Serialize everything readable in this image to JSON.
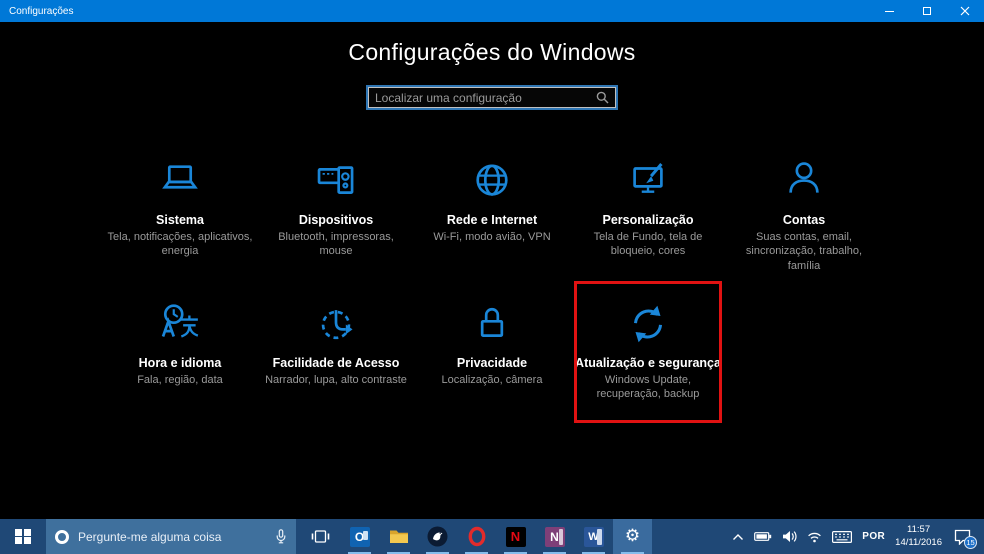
{
  "window": {
    "title": "Configurações"
  },
  "settings_app": {
    "heading": "Configurações do Windows",
    "search": {
      "placeholder": "Localizar uma configuração",
      "value": ""
    },
    "categories": [
      {
        "title": "Sistema",
        "subtitle": "Tela, notificações, aplicativos, energia",
        "icon": "laptop-icon"
      },
      {
        "title": "Dispositivos",
        "subtitle": "Bluetooth, impressoras, mouse",
        "icon": "devices-icon"
      },
      {
        "title": "Rede e Internet",
        "subtitle": "Wi-Fi, modo avião, VPN",
        "icon": "globe-icon"
      },
      {
        "title": "Personalização",
        "subtitle": "Tela de Fundo, tela de bloqueio, cores",
        "icon": "personalization-icon"
      },
      {
        "title": "Contas",
        "subtitle": "Suas contas, email, sincronização, trabalho, família",
        "icon": "person-icon"
      },
      {
        "title": "Hora e idioma",
        "subtitle": "Fala, região, data",
        "icon": "clock-language-icon"
      },
      {
        "title": "Facilidade de Acesso",
        "subtitle": "Narrador, lupa, alto contraste",
        "icon": "ease-of-access-icon"
      },
      {
        "title": "Privacidade",
        "subtitle": "Localização, câmera",
        "icon": "lock-icon"
      },
      {
        "title": "Atualização e segurança",
        "subtitle": "Windows Update, recuperação, backup",
        "icon": "sync-icon",
        "highlighted": true
      }
    ]
  },
  "taskbar": {
    "search": {
      "placeholder": "Pergunte-me alguma coisa",
      "value": ""
    },
    "apps": {
      "outlook_glyph": "O",
      "netflix_glyph": "N",
      "onenote_glyph": "N",
      "word_glyph": "W",
      "settings_glyph": "⚙"
    },
    "tray": {
      "language": "POR",
      "time": "11:57",
      "date": "14/11/2016",
      "notification_count": "15"
    }
  },
  "colors": {
    "accent": "#0078d7",
    "icon_blue": "#1a86d8",
    "highlight_red": "#e01212",
    "taskbar_bg": "#1f4876",
    "taskbar_search_bg": "#3f709d",
    "underline_blue": "#85bdec",
    "badge_blue": "#1e70c8"
  }
}
